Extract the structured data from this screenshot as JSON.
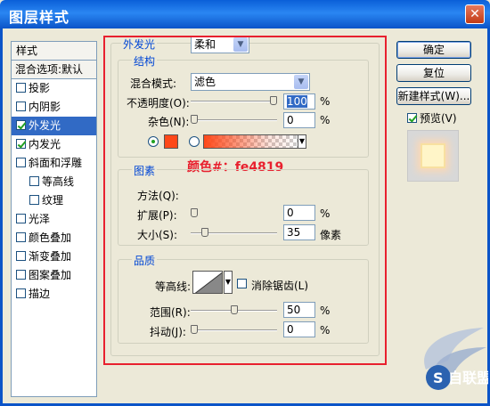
{
  "window": {
    "title": "图层样式",
    "close_glyph": "✕"
  },
  "style_list": {
    "header": "样式",
    "blend_options": "混合选项:默认",
    "items": [
      {
        "label": "投影",
        "checked": false,
        "sub": false,
        "selected": false
      },
      {
        "label": "内阴影",
        "checked": false,
        "sub": false,
        "selected": false
      },
      {
        "label": "外发光",
        "checked": true,
        "sub": false,
        "selected": true
      },
      {
        "label": "内发光",
        "checked": true,
        "sub": false,
        "selected": false
      },
      {
        "label": "斜面和浮雕",
        "checked": false,
        "sub": false,
        "selected": false
      },
      {
        "label": "等高线",
        "checked": false,
        "sub": true,
        "selected": false
      },
      {
        "label": "纹理",
        "checked": false,
        "sub": true,
        "selected": false
      },
      {
        "label": "光泽",
        "checked": false,
        "sub": false,
        "selected": false
      },
      {
        "label": "颜色叠加",
        "checked": false,
        "sub": false,
        "selected": false
      },
      {
        "label": "渐变叠加",
        "checked": false,
        "sub": false,
        "selected": false
      },
      {
        "label": "图案叠加",
        "checked": false,
        "sub": false,
        "selected": false
      },
      {
        "label": "描边",
        "checked": false,
        "sub": false,
        "selected": false
      }
    ]
  },
  "outer_glow": {
    "title": "外发光",
    "structure": {
      "title": "结构",
      "blend_mode_label": "混合模式:",
      "blend_mode_value": "滤色",
      "opacity_label": "不透明度(O):",
      "opacity_value": "100",
      "noise_label": "杂色(N):",
      "noise_value": "0",
      "percent": "%",
      "glow_color": "#fe4819"
    },
    "annotation": "颜色#：fe4819",
    "elements": {
      "title": "图素",
      "technique_label": "方法(Q):",
      "technique_value": "柔和",
      "spread_label": "扩展(P):",
      "spread_value": "0",
      "size_label": "大小(S):",
      "size_value": "35",
      "size_unit": "像素",
      "percent": "%"
    },
    "quality": {
      "title": "品质",
      "contour_label": "等高线:",
      "antialias_label": "消除锯齿(L)",
      "range_label": "范围(R):",
      "range_value": "50",
      "jitter_label": "抖动(J):",
      "jitter_value": "0",
      "percent": "%"
    }
  },
  "buttons": {
    "ok": "确定",
    "reset": "复位",
    "new_style": "新建样式(W)...",
    "preview_label": "预览(V)"
  },
  "slider_levels": {
    "opacity": 100,
    "noise": 0,
    "spread": 0,
    "size": 35,
    "range": 50,
    "jitter": 0
  },
  "watermark": {
    "text": "S 自联盟"
  }
}
